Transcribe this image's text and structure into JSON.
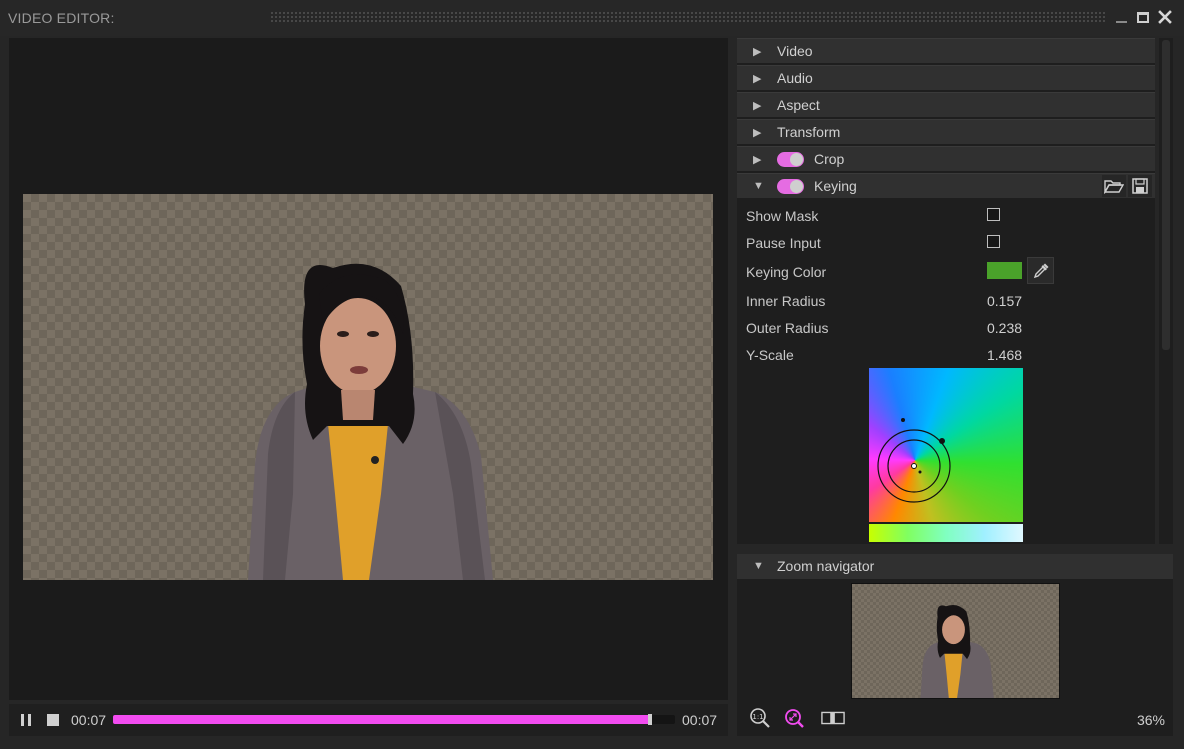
{
  "window": {
    "title": "VIDEO EDITOR:"
  },
  "transport": {
    "current_time": "00:07",
    "total_time": "00:07",
    "progress": 0.955
  },
  "sections": [
    {
      "label": "Video",
      "expanded": false
    },
    {
      "label": "Audio",
      "expanded": false
    },
    {
      "label": "Aspect",
      "expanded": false
    },
    {
      "label": "Transform",
      "expanded": false
    },
    {
      "label": "Crop",
      "expanded": false,
      "enabled": true
    },
    {
      "label": "Keying",
      "expanded": true,
      "enabled": true
    }
  ],
  "keying": {
    "show_mask": {
      "label": "Show Mask",
      "checked": false
    },
    "pause_input": {
      "label": "Pause Input",
      "checked": false
    },
    "keying_color": {
      "label": "Keying Color",
      "value": "#4aa22a"
    },
    "inner_radius": {
      "label": "Inner Radius",
      "value": "0.157"
    },
    "outer_radius": {
      "label": "Outer Radius",
      "value": "0.238"
    },
    "y_scale": {
      "label": "Y-Scale",
      "value": "1.468"
    }
  },
  "zoom_navigator": {
    "label": "Zoom navigator",
    "zoom_level": "36%"
  },
  "colors": {
    "accent": "#f24cf0",
    "toggle": "#e56ce2"
  }
}
